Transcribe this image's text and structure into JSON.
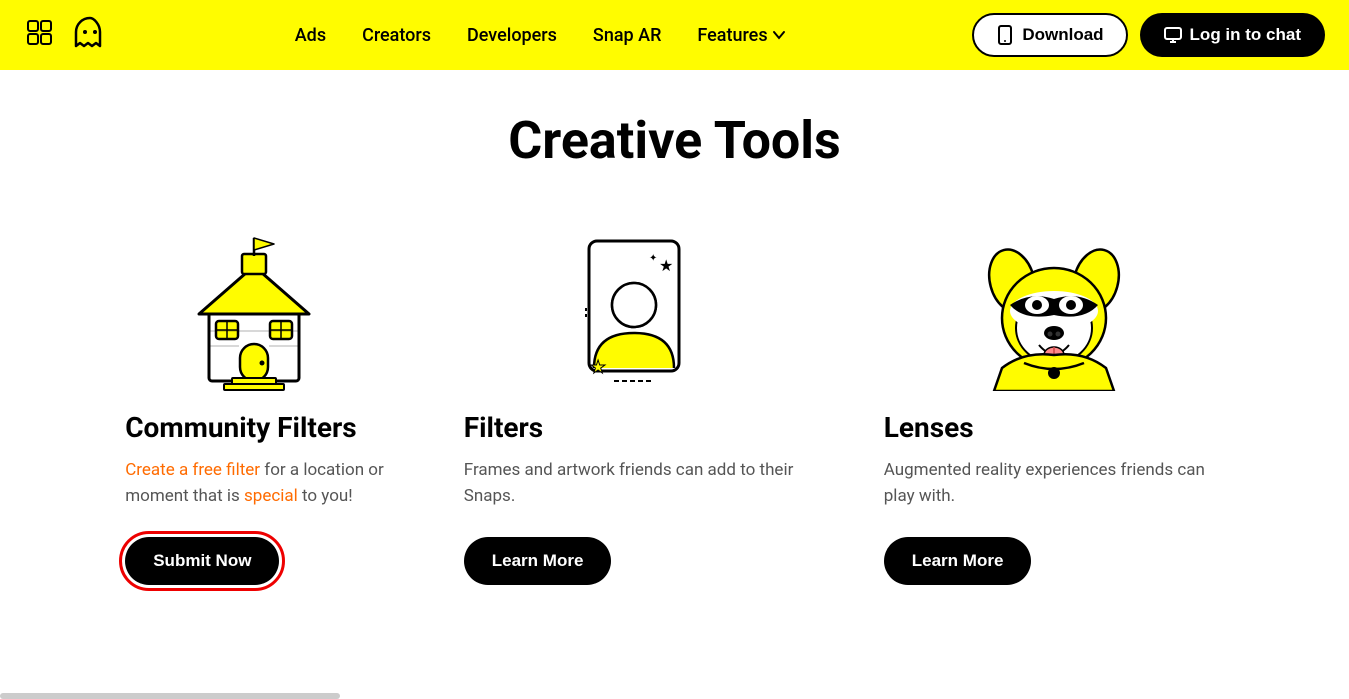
{
  "navbar": {
    "nav_links": [
      {
        "label": "Ads",
        "id": "ads"
      },
      {
        "label": "Creators",
        "id": "creators"
      },
      {
        "label": "Developers",
        "id": "developers"
      },
      {
        "label": "Snap AR",
        "id": "snap-ar"
      },
      {
        "label": "Features",
        "id": "features",
        "has_dropdown": true
      }
    ],
    "download_label": "Download",
    "login_label": "Log in to chat"
  },
  "main": {
    "page_title": "Creative Tools",
    "cards": [
      {
        "id": "community-filters",
        "title": "Community Filters",
        "description_parts": [
          {
            "text": "Create a free filter for a location or\nmoment that is ",
            "highlight": false
          },
          {
            "text": "special",
            "highlight": true
          },
          {
            "text": " to you!",
            "highlight": false
          }
        ],
        "description_plain": "Create a free filter for a location or moment that is special to you!",
        "button_label": "Submit Now",
        "button_type": "submit"
      },
      {
        "id": "filters",
        "title": "Filters",
        "description": "Frames and artwork friends can add to their Snaps.",
        "button_label": "Learn More",
        "button_type": "learn"
      },
      {
        "id": "lenses",
        "title": "Lenses",
        "description": "Augmented reality experiences friends can play with.",
        "button_label": "Learn More",
        "button_type": "learn"
      }
    ]
  }
}
